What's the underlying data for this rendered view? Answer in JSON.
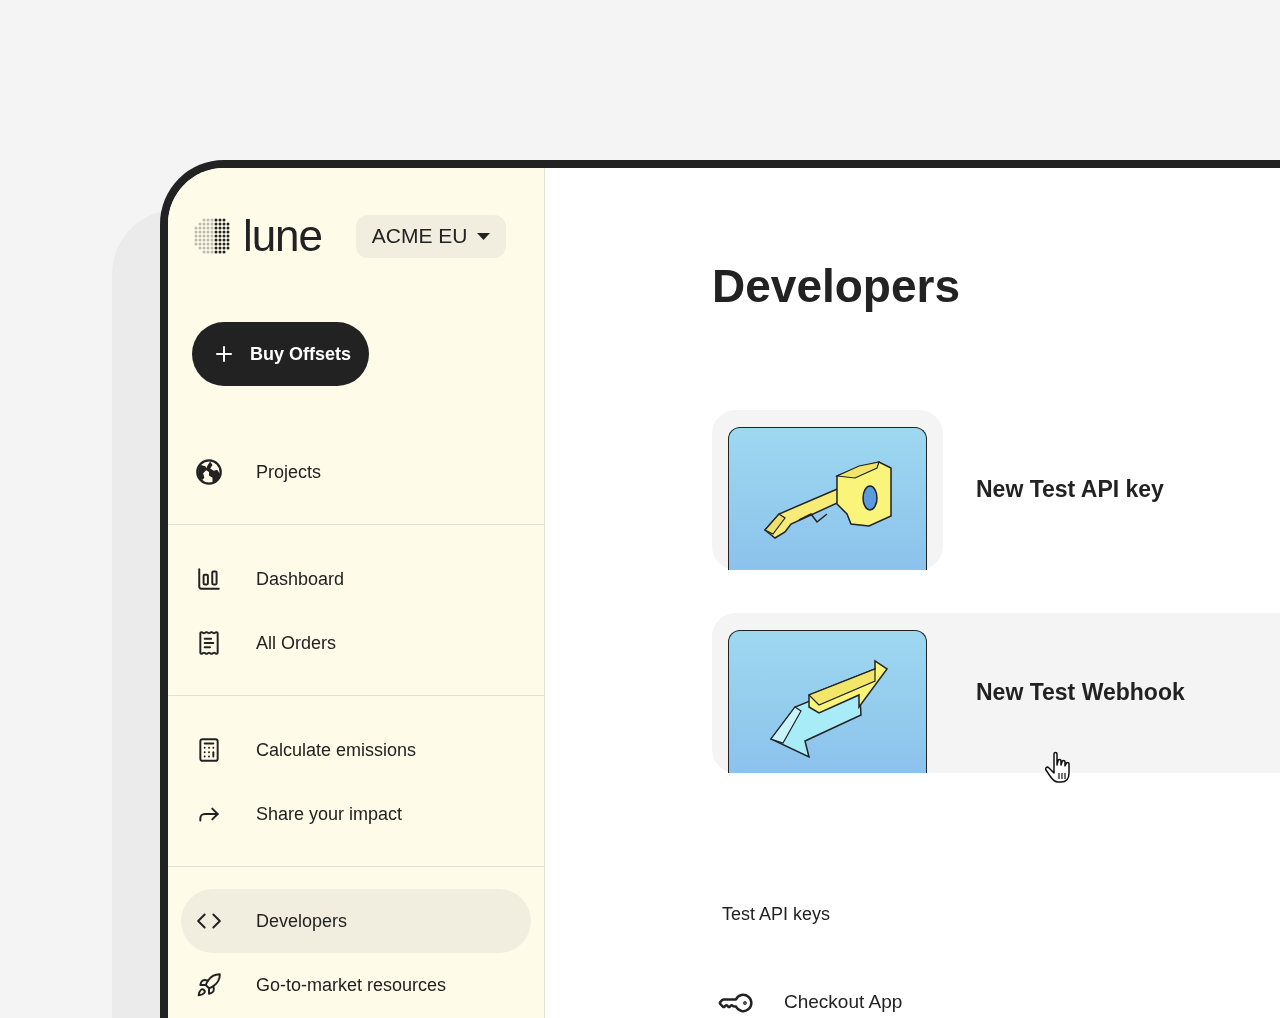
{
  "brand": {
    "name": "lune"
  },
  "org_switcher": {
    "label": "ACME EU"
  },
  "primary_action": {
    "label": "Buy Offsets"
  },
  "nav_groups": [
    [
      {
        "kind": "globe",
        "label": "Projects",
        "selected": false
      }
    ],
    [
      {
        "kind": "chart",
        "label": "Dashboard",
        "selected": false
      },
      {
        "kind": "receipt",
        "label": "All Orders",
        "selected": false
      }
    ],
    [
      {
        "kind": "calculator",
        "label": "Calculate emissions",
        "selected": false
      },
      {
        "kind": "share",
        "label": "Share your impact",
        "selected": false
      }
    ],
    [
      {
        "kind": "code",
        "label": "Developers",
        "selected": true
      },
      {
        "kind": "rocket",
        "label": "Go-to-market resources",
        "selected": false
      }
    ]
  ],
  "page_title": "Developers",
  "cards": [
    {
      "kind": "key",
      "title": "New Test API key",
      "highlighted": false
    },
    {
      "kind": "webhook",
      "title": "New Test Webhook",
      "highlighted": true
    }
  ],
  "api_keys": {
    "title": "Test API keys",
    "items": [
      {
        "label": "Checkout App"
      }
    ]
  }
}
